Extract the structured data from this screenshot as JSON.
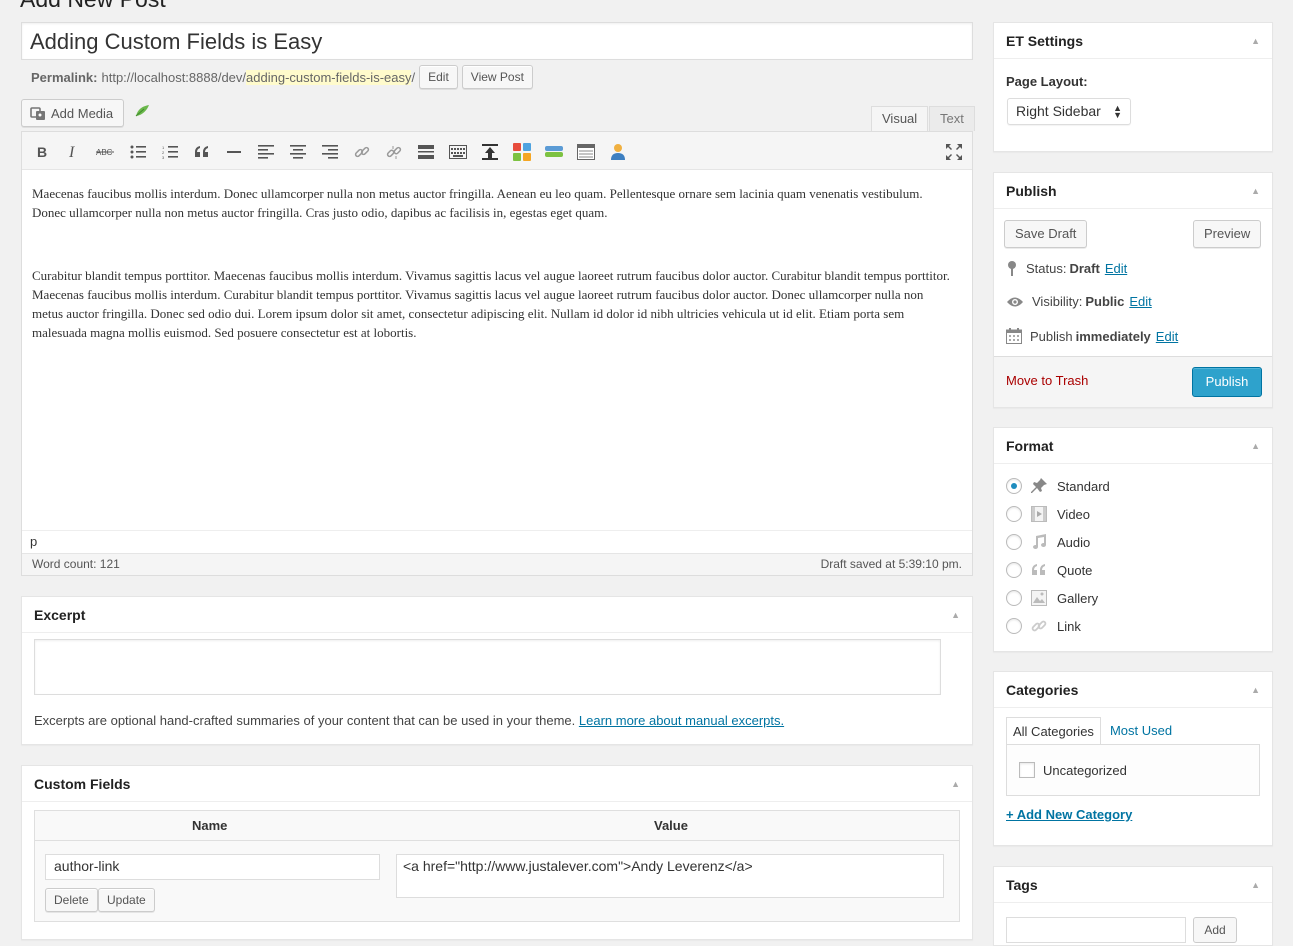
{
  "page": {
    "heading": "Add New Post"
  },
  "post": {
    "title": "Adding Custom Fields is Easy",
    "permalink_label": "Permalink:",
    "permalink_base": "http://localhost:8888/dev/",
    "permalink_slug": "adding-custom-fields-is-easy",
    "permalink_trailing": "/",
    "edit_label": "Edit",
    "view_post_label": "View Post"
  },
  "editor": {
    "add_media_label": "Add Media",
    "tab_visual": "Visual",
    "tab_text": "Text",
    "toolbar_icons": [
      "bold-icon",
      "italic-icon",
      "strikethrough-icon",
      "bullet-list-icon",
      "numbered-list-icon",
      "blockquote-icon",
      "horizontal-rule-icon",
      "align-left-icon",
      "align-center-icon",
      "align-right-icon",
      "link-icon",
      "unlink-icon",
      "read-more-icon",
      "toolbar-toggle-icon",
      "upload-icon",
      "color-grid-icon",
      "slider-icon",
      "table-icon",
      "user-icon",
      "fullscreen-icon"
    ],
    "paragraphs": [
      "Maecenas faucibus mollis interdum. Donec ullamcorper nulla non metus auctor fringilla. Aenean eu leo quam. Pellentesque ornare sem lacinia quam venenatis vestibulum. Donec ullamcorper nulla non metus auctor fringilla. Cras justo odio, dapibus ac facilisis in, egestas eget quam.",
      "Curabitur blandit tempus porttitor. Maecenas faucibus mollis interdum. Vivamus sagittis lacus vel augue laoreet rutrum faucibus dolor auctor. Curabitur blandit tempus porttitor. Maecenas faucibus mollis interdum. Curabitur blandit tempus porttitor. Vivamus sagittis lacus vel augue laoreet rutrum faucibus dolor auctor. Donec ullamcorper nulla non metus auctor fringilla. Donec sed odio dui. Lorem ipsum dolor sit amet, consectetur adipiscing elit. Nullam id dolor id nibh ultricies vehicula ut id elit. Etiam porta sem malesuada magna mollis euismod. Sed posuere consectetur est at lobortis."
    ],
    "path": "p",
    "word_count": "Word count: 121",
    "draft_saved": "Draft saved at 5:39:10 pm."
  },
  "excerpt": {
    "title": "Excerpt",
    "value": "",
    "help_text": "Excerpts are optional hand-crafted summaries of your content that can be used in your theme.",
    "help_link": "Learn more about manual excerpts."
  },
  "custom_fields": {
    "title": "Custom Fields",
    "col_name": "Name",
    "col_value": "Value",
    "rows": [
      {
        "name": "author-link",
        "value": "<a href=\"http://www.justalever.com\">Andy Leverenz</a>"
      }
    ],
    "delete_label": "Delete",
    "update_label": "Update"
  },
  "et_settings": {
    "title": "ET Settings",
    "page_layout_label": "Page Layout:",
    "page_layout_value": "Right Sidebar"
  },
  "publish": {
    "title": "Publish",
    "save_draft": "Save Draft",
    "preview": "Preview",
    "status_label": "Status:",
    "status_value": "Draft",
    "visibility_label": "Visibility:",
    "visibility_value": "Public",
    "schedule_label": "Publish",
    "schedule_value": "immediately",
    "edit": "Edit",
    "move_to_trash": "Move to Trash",
    "publish_button": "Publish"
  },
  "format": {
    "title": "Format",
    "selected": "Standard",
    "options": [
      {
        "label": "Standard",
        "icon": "pin-icon"
      },
      {
        "label": "Video",
        "icon": "video-icon"
      },
      {
        "label": "Audio",
        "icon": "audio-icon"
      },
      {
        "label": "Quote",
        "icon": "quote-icon"
      },
      {
        "label": "Gallery",
        "icon": "gallery-icon"
      },
      {
        "label": "Link",
        "icon": "link-icon"
      }
    ]
  },
  "categories": {
    "title": "Categories",
    "tab_all": "All Categories",
    "tab_most_used": "Most Used",
    "items": [
      "Uncategorized"
    ],
    "add_new": "+ Add New Category"
  },
  "tags": {
    "title": "Tags",
    "add_button": "Add"
  },
  "colors": {
    "accent": "#2ea2cc",
    "link": "#0074a2",
    "trash": "#aa0000",
    "slug_highlight": "#fffbcc"
  }
}
